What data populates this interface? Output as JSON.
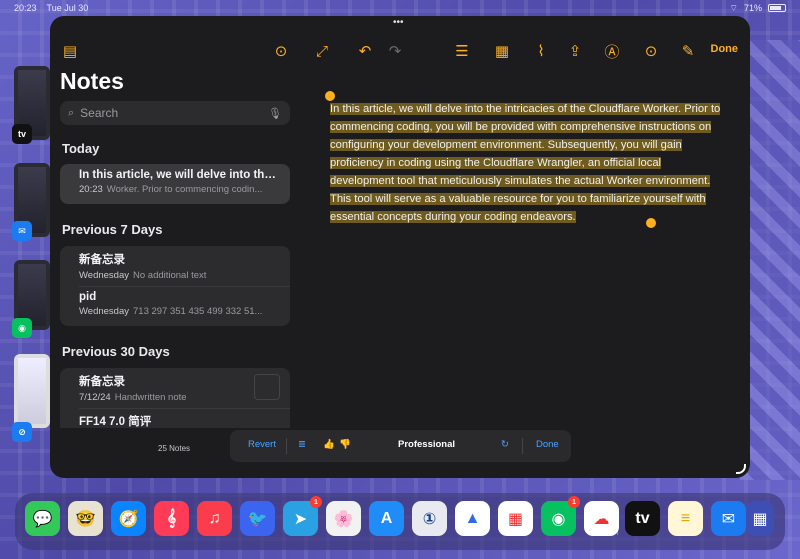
{
  "status": {
    "time": "20:23",
    "date": "Tue Jul 30",
    "battery": "71%"
  },
  "toolbar": {
    "done_label": "Done",
    "grip": "•••"
  },
  "sidebar": {
    "title": "Notes",
    "search_placeholder": "Search",
    "sections": [
      {
        "label": "Today"
      },
      {
        "label": "Previous 7 Days"
      },
      {
        "label": "Previous 30 Days"
      }
    ],
    "today": [
      {
        "title": "In this article, we will delve into the i...",
        "time": "20:23",
        "preview": "Worker. Prior to commencing codin..."
      }
    ],
    "week": [
      {
        "title": "新备忘录",
        "time": "Wednesday",
        "preview": "No additional text"
      },
      {
        "title": "pid",
        "time": "Wednesday",
        "preview": "713 297 351 435 499 332 51..."
      }
    ],
    "month": [
      {
        "title": "新备忘录",
        "time": "7/12/24",
        "preview": "Handwritten note"
      },
      {
        "title": "FF14 7.0 简评",
        "time": "",
        "preview": ""
      }
    ],
    "count": "25 Notes"
  },
  "editor": {
    "text": "In this article, we will delve into the intricacies of the Cloudflare Worker. Prior to commencing coding, you will be provided with comprehensive instructions on configuring your development environment. Subsequently, you will gain proficiency in coding using the Cloudflare Wrangler, an official local development tool that meticulously simulates the actual Worker environment. This tool will serve as a valuable resource for you to familiarize yourself with essential concepts during your coding endeavors."
  },
  "writing_tools": {
    "revert": "Revert",
    "mode": "Professional",
    "done": "Done"
  },
  "dock": {
    "badges": {
      "telegram": "1",
      "wechat": "1"
    },
    "apps": [
      "messages",
      "memoji",
      "safari",
      "music-score",
      "music",
      "bird",
      "telegram",
      "photos",
      "app-store",
      "1password",
      "send",
      "calendar-grid",
      "wechat",
      "cloud",
      "apple-tv",
      "notes",
      "mail",
      "app-library"
    ]
  },
  "stage_labels": {
    "tv": "tv"
  },
  "colors": {
    "accent": "#ffb020",
    "highlight": "#6f5b1e",
    "link": "#4aa3ff"
  }
}
